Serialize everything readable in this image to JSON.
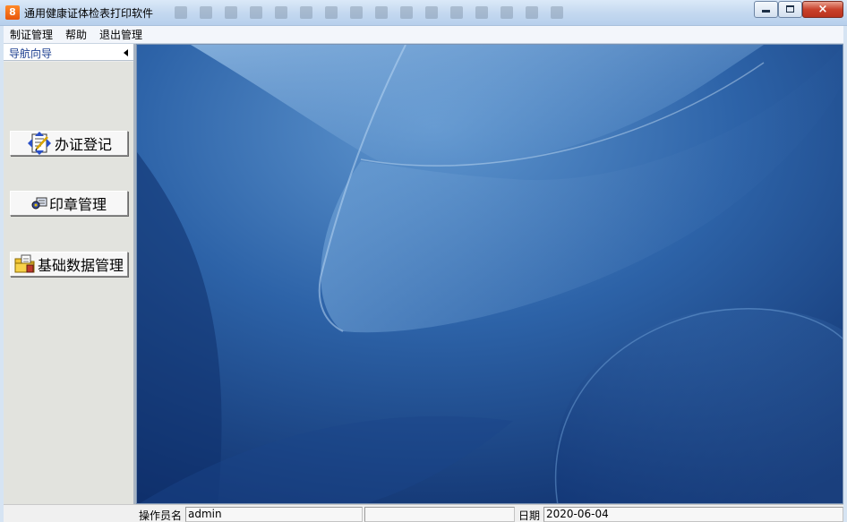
{
  "window": {
    "icon_text": "8",
    "title": "通用健康证体检表打印软件",
    "accent_color": "#e8560b"
  },
  "window_controls": {
    "minimize": "minimize-icon",
    "maximize": "maximize-icon",
    "close": "×"
  },
  "menu": {
    "items": [
      {
        "label": "制证管理"
      },
      {
        "label": "帮助"
      },
      {
        "label": "退出管理"
      }
    ]
  },
  "sidebar": {
    "title": "导航向导",
    "buttons": [
      {
        "label": "办证登记",
        "icon": "registration-icon"
      },
      {
        "label": "印章管理",
        "icon": "seal-icon"
      },
      {
        "label": "基础数据管理",
        "icon": "folder-data-icon"
      }
    ]
  },
  "desktop": {
    "background_color": "#173d7e"
  },
  "statusbar": {
    "operator_label": "操作员名",
    "operator_value": "admin",
    "date_label": "日期",
    "date_value": "2020-06-04"
  }
}
